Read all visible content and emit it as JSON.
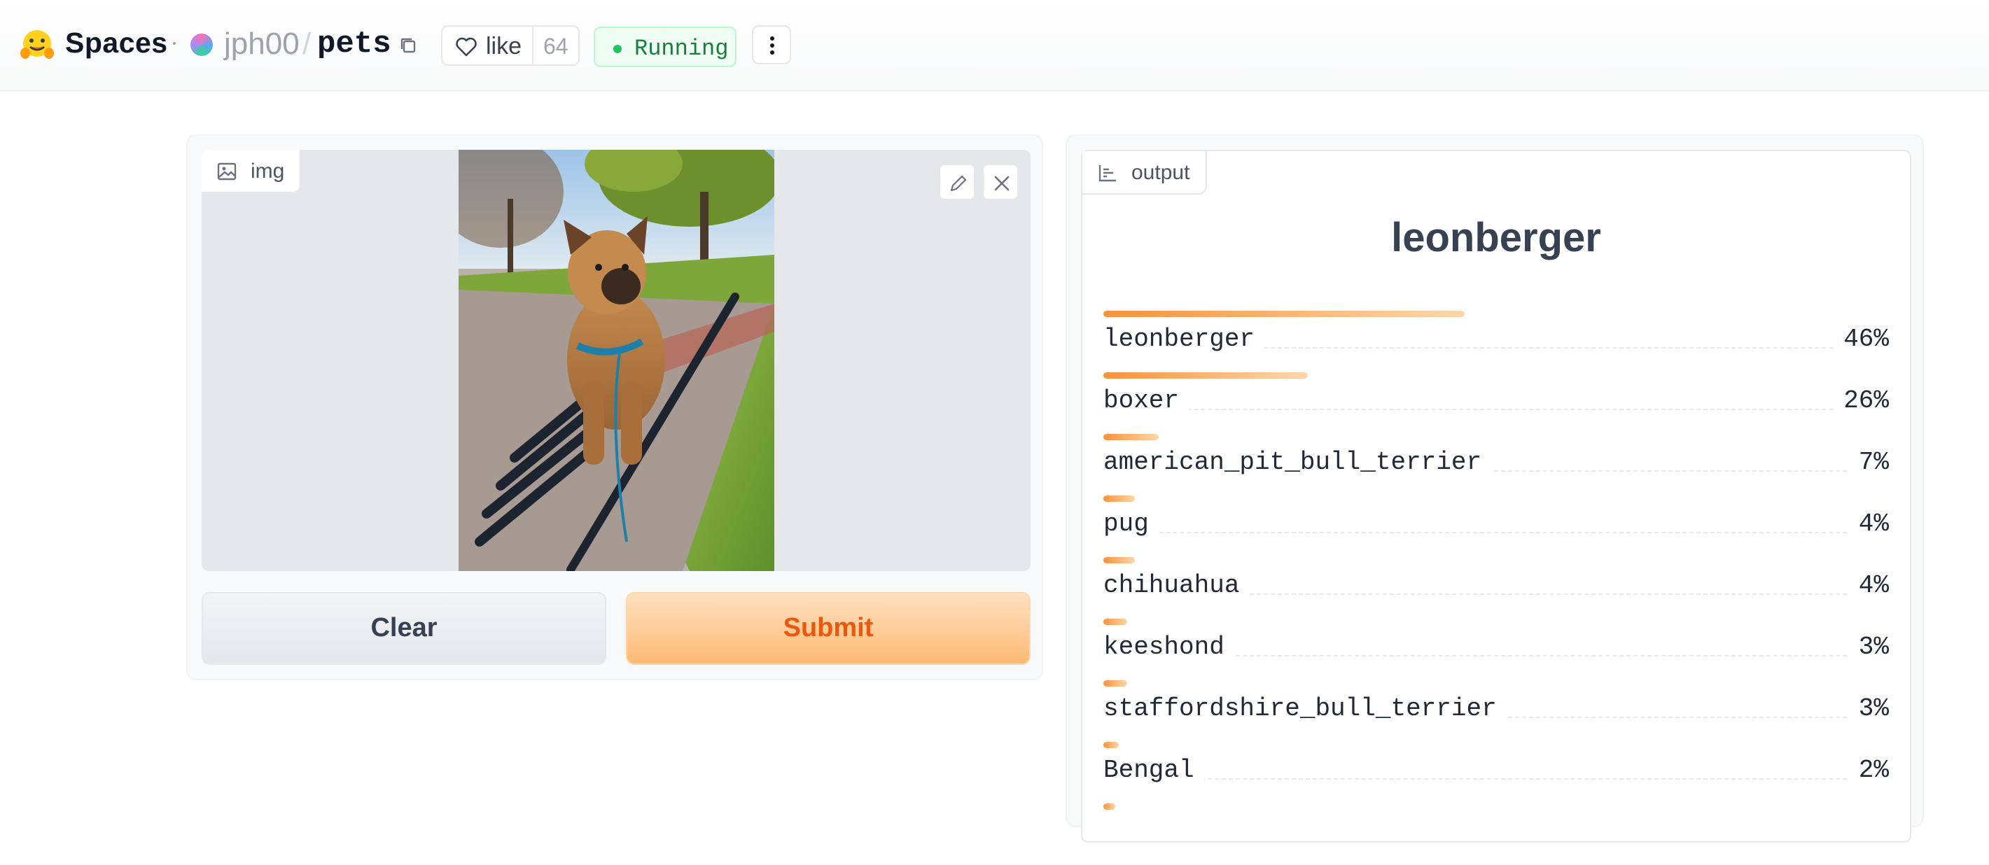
{
  "header": {
    "brand": "Spaces",
    "owner": "jph00",
    "separator": "/",
    "repo": "pets",
    "like_label": "like",
    "like_count": "64",
    "status": "Running"
  },
  "input": {
    "image_label": "img",
    "clear_label": "Clear",
    "submit_label": "Submit"
  },
  "output": {
    "label": "output",
    "top_prediction": "leonberger",
    "predictions": [
      {
        "name": "leonberger",
        "pct": "46%",
        "value": 0.46
      },
      {
        "name": "boxer",
        "pct": "26%",
        "value": 0.26
      },
      {
        "name": "american_pit_bull_terrier",
        "pct": "7%",
        "value": 0.07
      },
      {
        "name": "pug",
        "pct": "4%",
        "value": 0.04
      },
      {
        "name": "chihuahua",
        "pct": "4%",
        "value": 0.04
      },
      {
        "name": "keeshond",
        "pct": "3%",
        "value": 0.03
      },
      {
        "name": "staffordshire_bull_terrier",
        "pct": "3%",
        "value": 0.03
      },
      {
        "name": "Bengal",
        "pct": "2%",
        "value": 0.02
      },
      {
        "name": "",
        "pct": "",
        "value": 0.015
      }
    ]
  },
  "colors": {
    "accent": "#fb923c",
    "status_green": "#22c55e",
    "submit_text": "#ea580c"
  },
  "icons": [
    "hugging-face-logo-icon",
    "copy-icon",
    "heart-icon",
    "more-vertical-icon",
    "image-icon",
    "pencil-icon",
    "close-icon",
    "chart-icon"
  ]
}
